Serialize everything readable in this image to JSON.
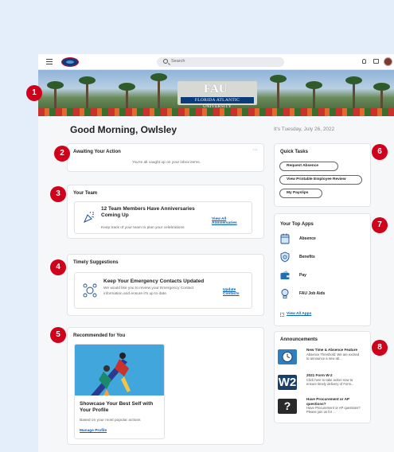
{
  "header": {
    "search_placeholder": "Search"
  },
  "banner": {
    "sign_fau": "FAU",
    "sign_plate": "FLORIDA ATLANTIC UNIVERSITY"
  },
  "greeting": "Good Morning, Owlsley",
  "date": "It's Tuesday, July 26, 2022",
  "awaiting": {
    "title": "Awaiting Your Action",
    "menu": "···",
    "message": "You're all caught up on your inbox items."
  },
  "team": {
    "title": "Your Team",
    "heading": "12 Team Members Have Anniversaries Coming Up",
    "text": "Keep track of your team to plan your celebrations",
    "link": "View All Anniversaries"
  },
  "suggestions": {
    "title": "Timely Suggestions",
    "heading": "Keep Your Emergency Contacts Updated",
    "text": "We would like you to review your Emergency Contact information and ensure it's up to date.",
    "link": "Update Contacts"
  },
  "recommended": {
    "title": "Recommended for You",
    "heading": "Showcase Your Best Self with Your Profile",
    "text": "Based on your most popular actions",
    "link": "Manage Profile"
  },
  "quick_tasks": {
    "title": "Quick Tasks",
    "buttons": [
      "Request Absence",
      "View Printable Employee Review",
      "My Payslips"
    ]
  },
  "top_apps": {
    "title": "Your Top Apps",
    "apps": [
      {
        "label": "Absence",
        "icon": "calendar-icon"
      },
      {
        "label": "Benefits",
        "icon": "shield-icon"
      },
      {
        "label": "Pay",
        "icon": "wallet-icon"
      },
      {
        "label": "FAU Job Aids",
        "icon": "lightbulb-icon"
      }
    ],
    "view_all": "View All Apps"
  },
  "announcements": {
    "title": "Announcements",
    "items": [
      {
        "title": "New Time & Absence Feature",
        "text": "Absence Threshold: We are excited to announce a new ab..."
      },
      {
        "title": "2021 Form W-2",
        "text": "Click here to take action now to ensure timely delivery of Form...",
        "thumb_text": "W2"
      },
      {
        "title": "Have Procurement or AP questions?",
        "text": "Have Procurement or AP questions? Please join us for ...",
        "thumb_text": "?"
      }
    ]
  },
  "markers": [
    "1",
    "2",
    "3",
    "4",
    "5",
    "6",
    "7",
    "8"
  ],
  "colors": {
    "marker_red": "#d0021b",
    "link_blue": "#0b5fb3",
    "fau_blue": "#0c3b7a"
  }
}
